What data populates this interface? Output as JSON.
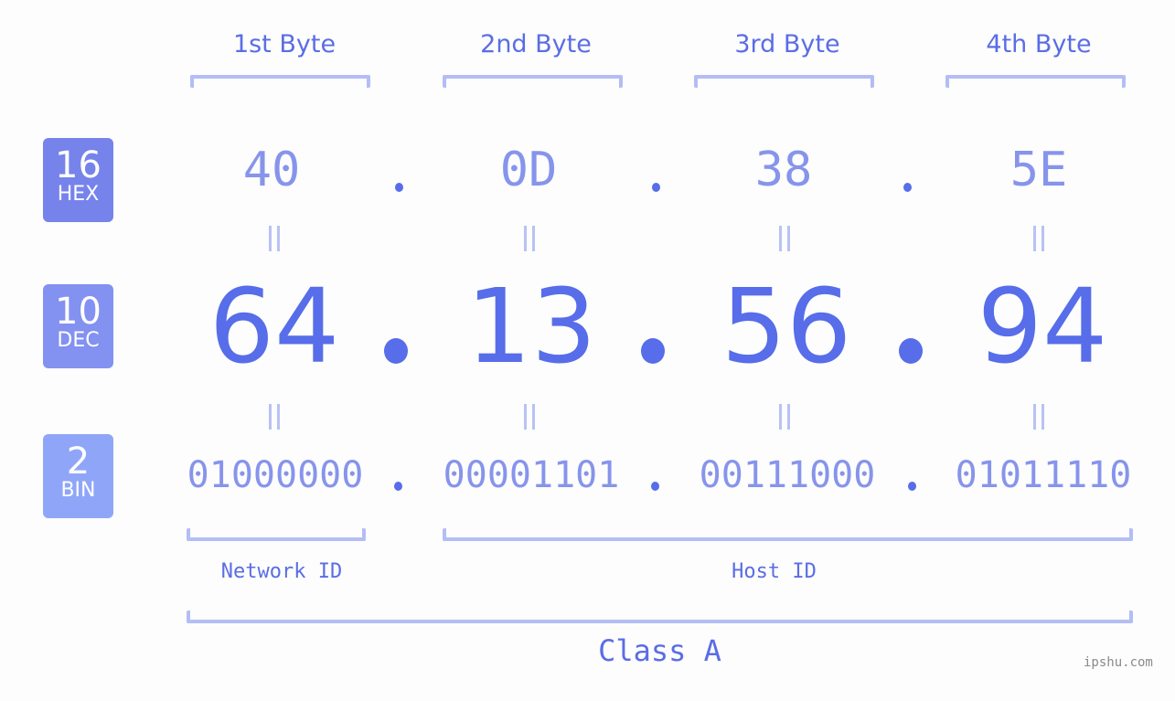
{
  "byte_headers": [
    "1st Byte",
    "2nd Byte",
    "3rd Byte",
    "4th Byte"
  ],
  "rows": {
    "hex": {
      "base": "16",
      "label": "HEX",
      "color": "#7683eb",
      "values": [
        "40",
        "0D",
        "38",
        "5E"
      ]
    },
    "dec": {
      "base": "10",
      "label": "DEC",
      "color": "#8391f0",
      "values": [
        "64",
        "13",
        "56",
        "94"
      ]
    },
    "bin": {
      "base": "2",
      "label": "BIN",
      "color": "#8fa6f8",
      "values": [
        "01000000",
        "00001101",
        "00111000",
        "01011110"
      ]
    }
  },
  "separator": ".",
  "network_id_label": "Network ID",
  "host_id_label": "Host ID",
  "class_label": "Class A",
  "watermark": "ipshu.com",
  "colors": {
    "accent": "#576de9",
    "bracket": "#b3bdf6",
    "muted_value": "#8794ec"
  }
}
